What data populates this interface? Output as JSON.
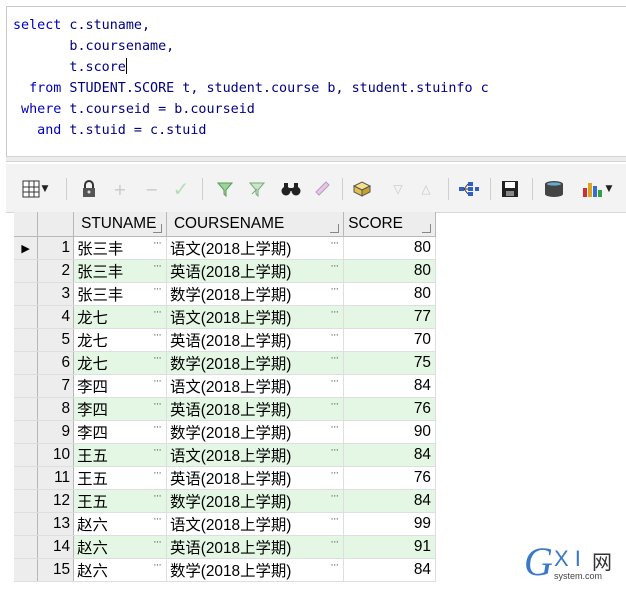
{
  "sql": {
    "lines": [
      {
        "kw": "select",
        "rest": " c.stuname,"
      },
      {
        "kw": "",
        "rest": "       b.coursename,"
      },
      {
        "kw": "",
        "rest": "       t.score"
      },
      {
        "kw": "  from",
        "rest": " STUDENT.SCORE t, student.course b, student.stuinfo c"
      },
      {
        "kw": " where",
        "rest": " t.courseid = b.courseid"
      },
      {
        "kw": "   and",
        "rest": " t.stuid = c.stuid"
      }
    ]
  },
  "toolbar": {
    "icons": [
      "grid-menu-icon",
      "lock-icon",
      "add-record-icon",
      "delete-record-icon",
      "post-changes-icon",
      "filter-icon",
      "clear-filter-icon",
      "find-icon",
      "clear-icon",
      "export-icon",
      "next-page-icon",
      "prev-page-icon",
      "query-plan-icon",
      "save-icon",
      "fetch-all-icon",
      "chart-icon"
    ]
  },
  "grid": {
    "columns": [
      "STUNAME",
      "COURSENAME",
      "SCORE"
    ],
    "ellipsis": "···",
    "current_indicator": "▶",
    "rows": [
      {
        "no": "1",
        "name": "张三丰",
        "course": "语文(2018上学期)",
        "score": "80"
      },
      {
        "no": "2",
        "name": "张三丰",
        "course": "英语(2018上学期)",
        "score": "80"
      },
      {
        "no": "3",
        "name": "张三丰",
        "course": "数学(2018上学期)",
        "score": "80"
      },
      {
        "no": "4",
        "name": "龙七",
        "course": "语文(2018上学期)",
        "score": "77"
      },
      {
        "no": "5",
        "name": "龙七",
        "course": "英语(2018上学期)",
        "score": "70"
      },
      {
        "no": "6",
        "name": "龙七",
        "course": "数学(2018上学期)",
        "score": "75"
      },
      {
        "no": "7",
        "name": "李四",
        "course": "语文(2018上学期)",
        "score": "84"
      },
      {
        "no": "8",
        "name": "李四",
        "course": "英语(2018上学期)",
        "score": "76"
      },
      {
        "no": "9",
        "name": "李四",
        "course": "数学(2018上学期)",
        "score": "90"
      },
      {
        "no": "10",
        "name": "王五",
        "course": "语文(2018上学期)",
        "score": "84"
      },
      {
        "no": "11",
        "name": "王五",
        "course": "英语(2018上学期)",
        "score": "76"
      },
      {
        "no": "12",
        "name": "王五",
        "course": "数学(2018上学期)",
        "score": "84"
      },
      {
        "no": "13",
        "name": "赵六",
        "course": "语文(2018上学期)",
        "score": "99"
      },
      {
        "no": "14",
        "name": "赵六",
        "course": "英语(2018上学期)",
        "score": "91"
      },
      {
        "no": "15",
        "name": "赵六",
        "course": "数学(2018上学期)",
        "score": "84"
      }
    ]
  },
  "watermark": {
    "g": "G",
    "xi": "X I",
    "cn": "网",
    "url": "system.com"
  }
}
